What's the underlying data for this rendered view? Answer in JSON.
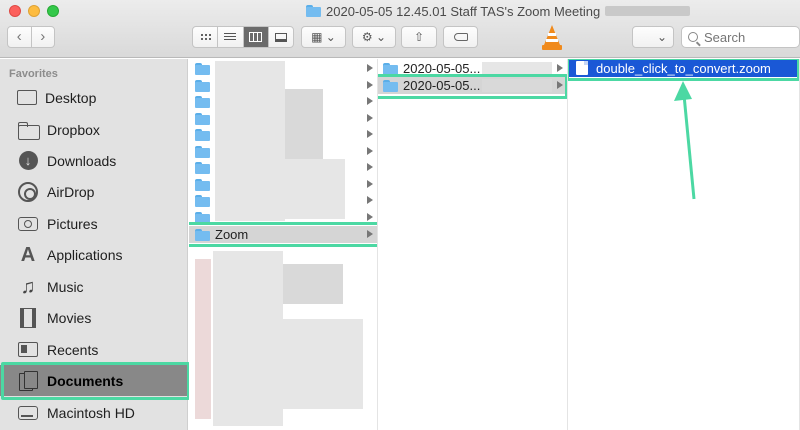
{
  "window": {
    "title": "2020-05-05 12.45.01 Staff TAS's Zoom Meeting"
  },
  "toolbar": {
    "back_glyph": "‹",
    "forward_glyph": "›",
    "search_placeholder": "Search",
    "share_glyph": "⇧",
    "action_glyph": "⚙ ⌄",
    "group_glyph": "▦ ⌄",
    "dropdown_glyph": "⌄"
  },
  "sidebar": {
    "header": "Favorites",
    "items": [
      {
        "label": "Desktop",
        "icon": "desktop-icon"
      },
      {
        "label": "Dropbox",
        "icon": "folder-icon"
      },
      {
        "label": "Downloads",
        "icon": "download-icon"
      },
      {
        "label": "AirDrop",
        "icon": "airdrop-icon"
      },
      {
        "label": "Pictures",
        "icon": "camera-icon"
      },
      {
        "label": "Applications",
        "icon": "applications-icon"
      },
      {
        "label": "Music",
        "icon": "music-icon"
      },
      {
        "label": "Movies",
        "icon": "movies-icon"
      },
      {
        "label": "Recents",
        "icon": "recents-icon"
      },
      {
        "label": "Documents",
        "icon": "documents-icon",
        "selected": true
      },
      {
        "label": "Macintosh HD",
        "icon": "hard-drive-icon"
      }
    ]
  },
  "column1": {
    "selected_folder": "Zoom"
  },
  "column2": {
    "folders": [
      "2020-05-05...",
      "2020-05-05..."
    ]
  },
  "column3": {
    "selected_file": "double_click_to_convert.zoom"
  },
  "colors": {
    "highlight": "#4cd8a3",
    "selection": "#1a58d6"
  }
}
